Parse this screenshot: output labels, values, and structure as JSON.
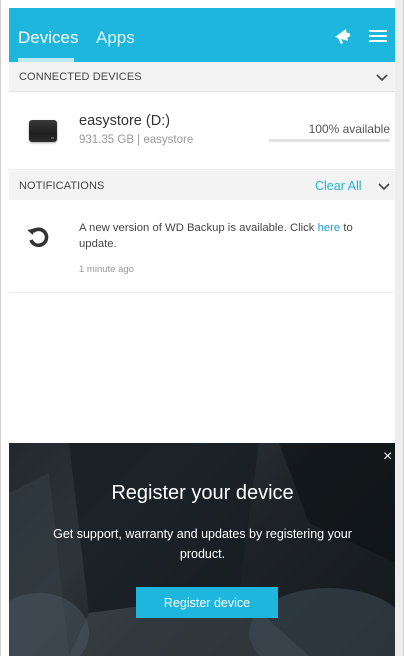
{
  "header": {
    "tabs": [
      {
        "label": "Devices",
        "active": true
      },
      {
        "label": "Apps",
        "active": false
      }
    ],
    "icons": [
      "megaphone-icon",
      "menu-icon"
    ],
    "accent_color": "#1eb6dc"
  },
  "connected_devices": {
    "title": "CONNECTED DEVICES",
    "devices": [
      {
        "name": "easystore (D:)",
        "meta": "931.35 GB | easystore",
        "availability": "100% available",
        "available_fraction": 1.0
      }
    ]
  },
  "notifications": {
    "title": "NOTIFICATIONS",
    "clear_all": "Clear All",
    "items": [
      {
        "text_before": "A new version of WD Backup is available. Click ",
        "link": "here",
        "text_after": " to update.",
        "time": "1 minute ago"
      }
    ]
  },
  "banner": {
    "title": "Register your device",
    "text": "Get support, warranty and updates by registering your product.",
    "button": "Register device",
    "close": "×"
  }
}
